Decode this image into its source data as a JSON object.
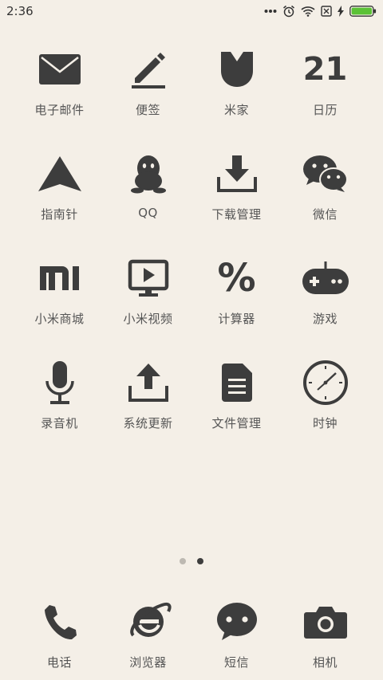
{
  "status_bar": {
    "time": "2:36",
    "battery_color": "#5bc236"
  },
  "apps": [
    {
      "label": "电子邮件",
      "icon": "mail-icon"
    },
    {
      "label": "便签",
      "icon": "pencil-icon"
    },
    {
      "label": "米家",
      "icon": "mijia-icon"
    },
    {
      "label": "日历",
      "icon": "calendar-icon",
      "icon_text": "21"
    },
    {
      "label": "指南针",
      "icon": "compass-icon"
    },
    {
      "label": "QQ",
      "icon": "qq-penguin-icon"
    },
    {
      "label": "下载管理",
      "icon": "download-icon"
    },
    {
      "label": "微信",
      "icon": "wechat-icon"
    },
    {
      "label": "小米商城",
      "icon": "mi-logo-icon"
    },
    {
      "label": "小米视频",
      "icon": "video-player-icon"
    },
    {
      "label": "计算器",
      "icon": "percent-icon",
      "icon_text": "%"
    },
    {
      "label": "游戏",
      "icon": "gamepad-icon"
    },
    {
      "label": "录音机",
      "icon": "microphone-icon"
    },
    {
      "label": "系统更新",
      "icon": "upload-icon"
    },
    {
      "label": "文件管理",
      "icon": "file-icon"
    },
    {
      "label": "时钟",
      "icon": "clock-icon"
    }
  ],
  "page_indicator": {
    "count": 2,
    "active_index": 1
  },
  "dock": [
    {
      "label": "电话",
      "icon": "phone-icon"
    },
    {
      "label": "浏览器",
      "icon": "browser-icon"
    },
    {
      "label": "短信",
      "icon": "message-icon"
    },
    {
      "label": "相机",
      "icon": "camera-icon"
    }
  ],
  "colors": {
    "background": "#f4efe7",
    "icon": "#3d3d3d",
    "label": "#555555"
  }
}
